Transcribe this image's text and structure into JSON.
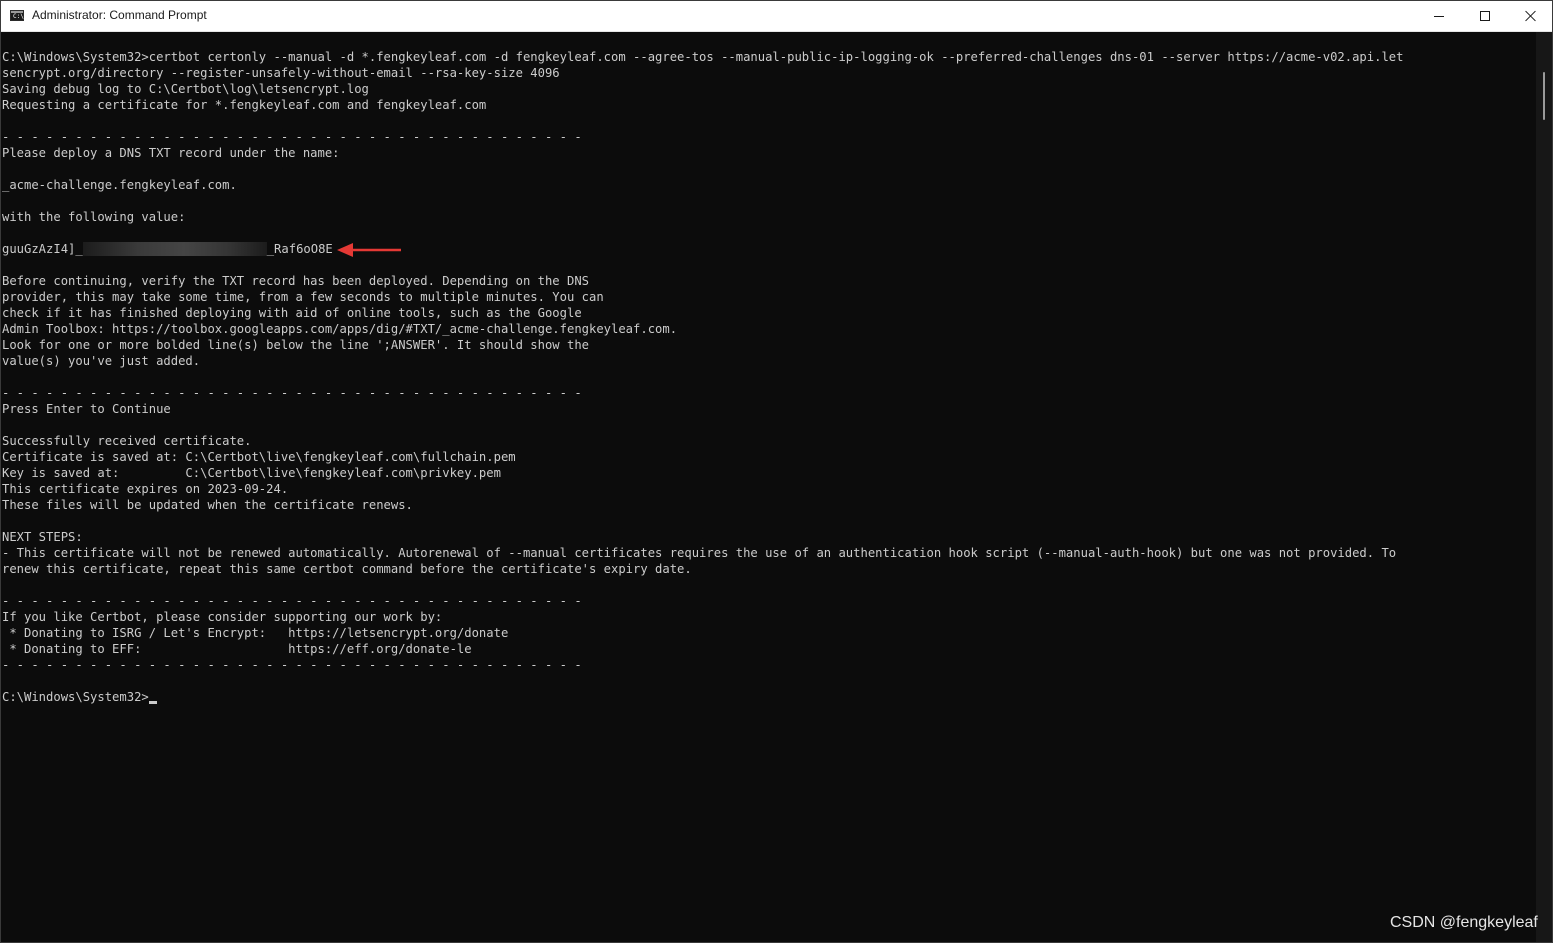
{
  "window": {
    "title": "Administrator: Command Prompt",
    "icon": "cmd-app-icon",
    "icon_glyph": "C:\\",
    "controls": {
      "minimize": "minimize-icon",
      "maximize": "maximize-icon",
      "close": "close-icon"
    }
  },
  "console": {
    "lines": [
      "C:\\Windows\\System32>certbot certonly --manual -d *.fengkeyleaf.com -d fengkeyleaf.com --agree-tos --manual-public-ip-logging-ok --preferred-challenges dns-01 --server https://acme-v02.api.let",
      "sencrypt.org/directory --register-unsafely-without-email --rsa-key-size 4096",
      "Saving debug log to C:\\Certbot\\log\\letsencrypt.log",
      "Requesting a certificate for *.fengkeyleaf.com and fengkeyleaf.com",
      "",
      "- - - - - - - - - - - - - - - - - - - - - - - - - - - - - - - - - - - - - - - -",
      "Please deploy a DNS TXT record under the name:",
      "",
      "_acme-challenge.fengkeyleaf.com.",
      "",
      "with the following value:",
      "",
      "",
      "",
      "Before continuing, verify the TXT record has been deployed. Depending on the DNS",
      "provider, this may take some time, from a few seconds to multiple minutes. You can",
      "check if it has finished deploying with aid of online tools, such as the Google",
      "Admin Toolbox: https://toolbox.googleapps.com/apps/dig/#TXT/_acme-challenge.fengkeyleaf.com.",
      "Look for one or more bolded line(s) below the line ';ANSWER'. It should show the",
      "value(s) you've just added.",
      "",
      "- - - - - - - - - - - - - - - - - - - - - - - - - - - - - - - - - - - - - - - -",
      "Press Enter to Continue",
      "",
      "Successfully received certificate.",
      "Certificate is saved at: C:\\Certbot\\live\\fengkeyleaf.com\\fullchain.pem",
      "Key is saved at:         C:\\Certbot\\live\\fengkeyleaf.com\\privkey.pem",
      "This certificate expires on 2023-09-24.",
      "These files will be updated when the certificate renews.",
      "",
      "NEXT STEPS:",
      "- This certificate will not be renewed automatically. Autorenewal of --manual certificates requires the use of an authentication hook script (--manual-auth-hook) but one was not provided. To",
      "renew this certificate, repeat this same certbot command before the certificate's expiry date.",
      "",
      "- - - - - - - - - - - - - - - - - - - - - - - - - - - - - - - - - - - - - - - -",
      "If you like Certbot, please consider supporting our work by:",
      " * Donating to ISRG / Let's Encrypt:   https://letsencrypt.org/donate",
      " * Donating to EFF:                    https://eff.org/donate-le",
      "- - - - - - - - - - - - - - - - - - - - - - - - - - - - - - - - - - - - - - - -",
      ""
    ],
    "txt_value_prefix": "guuGzAzI4]_",
    "txt_value_suffix": "_Raf6oO8E",
    "prompt": "C:\\Windows\\System32>",
    "annotation_arrow_color": "#e53935",
    "text_color": "#cccccc",
    "background_color": "#0c0c0c"
  },
  "watermark": "CSDN @fengkeyleaf"
}
